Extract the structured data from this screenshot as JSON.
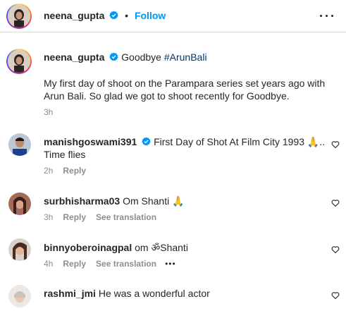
{
  "header": {
    "username": "neena_gupta",
    "separator": "•",
    "follow_label": "Follow"
  },
  "caption": {
    "username": "neena_gupta",
    "title_text": "Goodbye",
    "hashtag": "#ArunBali",
    "body": "My first day of shoot on the Parampara series set years ago with Arun Bali. So glad we got to shoot recently for Goodbye.",
    "time": "3h"
  },
  "comments": [
    {
      "username": "manishgoswami391",
      "verified": true,
      "text": "First Day of Shot At Film City 1993 🙏..",
      "text_line2": "Time flies",
      "time": "2h",
      "reply_label": "Reply",
      "see_translation": ""
    },
    {
      "username": "surbhisharma03",
      "verified": false,
      "text": "Om Shanti 🙏",
      "time": "3h",
      "reply_label": "Reply",
      "see_translation": "See translation"
    },
    {
      "username": "binnyoberoinagpal",
      "verified": false,
      "text": "om ॐShanti",
      "time": "4h",
      "reply_label": "Reply",
      "see_translation": "See translation",
      "more": "•••"
    },
    {
      "username": "rashmi_jmi",
      "verified": false,
      "text": "He was a wonderful actor"
    }
  ],
  "colors": {
    "link": "#0095f6",
    "hashtag": "#00376b",
    "secondary": "#8e8e8e",
    "verified": "#0095f6"
  },
  "icons": {
    "verified": "verified-badge-icon",
    "more": "more-options-icon",
    "like": "heart-icon",
    "ellipsis": "ellipsis-icon"
  }
}
